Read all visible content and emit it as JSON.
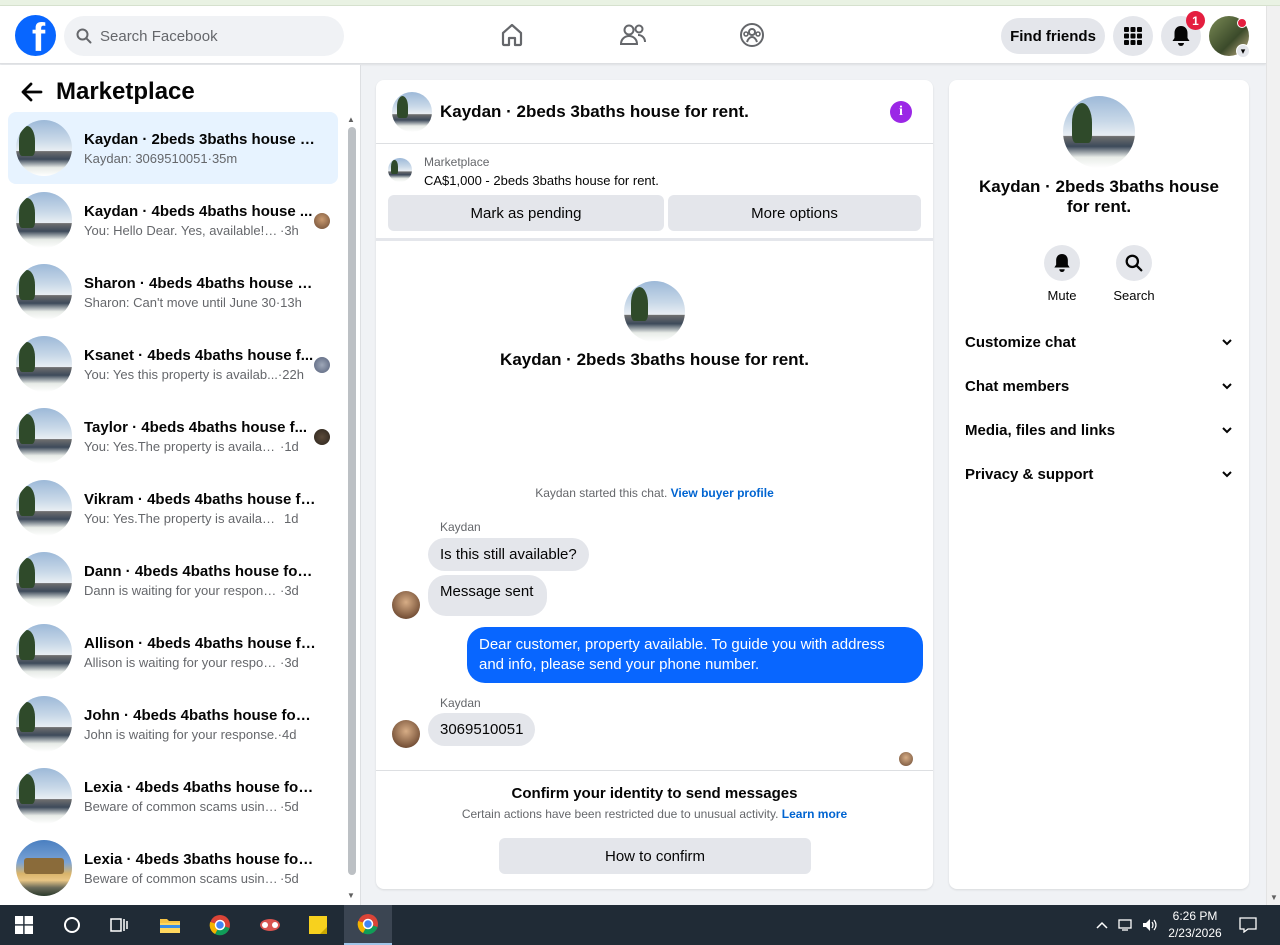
{
  "header": {
    "search_placeholder": "Search Facebook",
    "find_friends_label": "Find friends",
    "notification_count": "1"
  },
  "sidebar": {
    "title": "Marketplace",
    "conversations": [
      {
        "title": "Kaydan · 2beds 3baths house fo...",
        "snippet": "Kaydan: 3069510051",
        "time": "·35m",
        "active": true
      },
      {
        "title": "Kaydan · 4beds 4baths house ...",
        "snippet": "You: Hello Dear. Yes, available! Pl...",
        "time": "·3h"
      },
      {
        "title": "Sharon · 4beds 4baths house for...",
        "snippet": "Sharon: Can't move until June 30",
        "time": "·13h"
      },
      {
        "title": "Ksanet · 4beds 4baths house f...",
        "snippet": "You: Yes this property is availab...",
        "time": "·22h"
      },
      {
        "title": "Taylor · 4beds 4baths house f...",
        "snippet": "You: Yes.The property is availabl...",
        "time": "·1d"
      },
      {
        "title": "Vikram · 4beds 4baths house for...",
        "snippet": "You: Yes.The property is available. It...",
        "time": "1d"
      },
      {
        "title": "Dann · 4beds 4baths house for r...",
        "snippet": "Dann is waiting for your response.",
        "time": "·3d"
      },
      {
        "title": "Allison · 4beds 4baths house for...",
        "snippet": "Allison is waiting for your response.",
        "time": "·3d"
      },
      {
        "title": "John · 4beds 4baths house for r...",
        "snippet": "John is waiting for your response.",
        "time": "·4d"
      },
      {
        "title": "Lexia · 4beds 4baths house for r...",
        "snippet": "Beware of common scams using pa...",
        "time": "·5d"
      },
      {
        "title": "Lexia · 4beds 3baths house for r...",
        "snippet": "Beware of common scams using pa...",
        "time": "·5d"
      }
    ]
  },
  "chat": {
    "title": "Kaydan · 2beds 3baths house for rent.",
    "listing_label": "Marketplace",
    "listing_desc": "CA$1,000 - 2beds 3baths house for rent.",
    "mark_pending": "Mark as pending",
    "more_options": "More options",
    "center_title": "Kaydan · 2beds 3baths house for rent.",
    "started_text": "Kaydan started this chat.",
    "view_buyer": "View buyer profile",
    "sender1": "Kaydan",
    "msg1": "Is this still available?",
    "msg2": "Message sent",
    "msg_out": "Dear customer, property available. To guide you with address and info, please send your phone number.",
    "sender2": "Kaydan",
    "msg3": "3069510051",
    "confirm_title": "Confirm your identity to send messages",
    "confirm_sub": "Certain actions have been restricted due to unusual activity.",
    "learn_more": "Learn more",
    "how_confirm": "How to confirm"
  },
  "right_panel": {
    "name": "Kaydan · 2beds 3baths house for rent.",
    "mute": "Mute",
    "search": "Search",
    "rows": [
      "Customize chat",
      "Chat members",
      "Media, files and links",
      "Privacy & support"
    ]
  },
  "taskbar": {
    "time": "6:26 PM",
    "date": "2/23/2026"
  }
}
